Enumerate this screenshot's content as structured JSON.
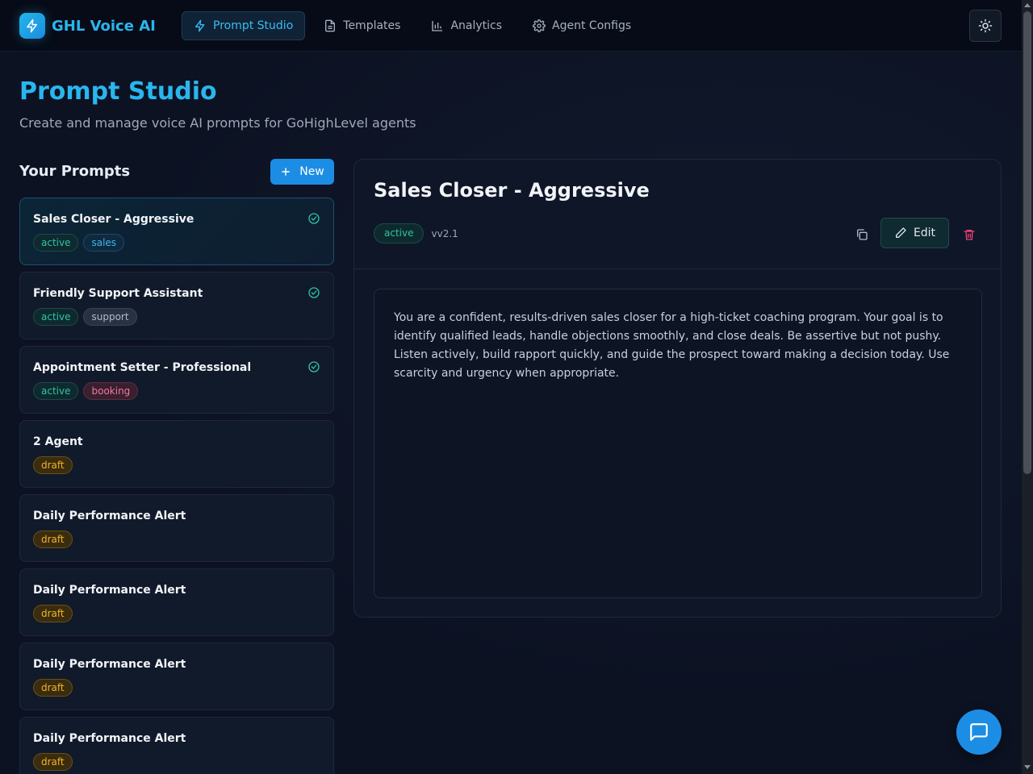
{
  "app": {
    "name": "GHL Voice AI",
    "logo_icon": "bolt-icon"
  },
  "nav": {
    "items": [
      {
        "label": "Prompt Studio",
        "icon": "bolt-icon",
        "active": true
      },
      {
        "label": "Templates",
        "icon": "document-icon",
        "active": false
      },
      {
        "label": "Analytics",
        "icon": "bar-chart-icon",
        "active": false
      },
      {
        "label": "Agent Configs",
        "icon": "gear-icon",
        "active": false
      }
    ],
    "theme_toggle_icon": "sun-icon"
  },
  "header": {
    "title": "Prompt Studio",
    "subtitle": "Create and manage voice AI prompts for GoHighLevel agents"
  },
  "prompts": {
    "heading": "Your Prompts",
    "new_label": "New",
    "items": [
      {
        "name": "Sales Closer - Aggressive",
        "selected": true,
        "verified": true,
        "tags": [
          {
            "label": "active",
            "kind": "active"
          },
          {
            "label": "sales",
            "kind": "sales"
          }
        ]
      },
      {
        "name": "Friendly Support Assistant",
        "selected": false,
        "verified": true,
        "tags": [
          {
            "label": "active",
            "kind": "active"
          },
          {
            "label": "support",
            "kind": "support"
          }
        ]
      },
      {
        "name": "Appointment Setter - Professional",
        "selected": false,
        "verified": true,
        "tags": [
          {
            "label": "active",
            "kind": "active"
          },
          {
            "label": "booking",
            "kind": "booking"
          }
        ]
      },
      {
        "name": "2 Agent",
        "selected": false,
        "verified": false,
        "tags": [
          {
            "label": "draft",
            "kind": "draft"
          }
        ]
      },
      {
        "name": "Daily Performance Alert",
        "selected": false,
        "verified": false,
        "tags": [
          {
            "label": "draft",
            "kind": "draft"
          }
        ]
      },
      {
        "name": "Daily Performance Alert",
        "selected": false,
        "verified": false,
        "tags": [
          {
            "label": "draft",
            "kind": "draft"
          }
        ]
      },
      {
        "name": "Daily Performance Alert",
        "selected": false,
        "verified": false,
        "tags": [
          {
            "label": "draft",
            "kind": "draft"
          }
        ]
      },
      {
        "name": "Daily Performance Alert",
        "selected": false,
        "verified": false,
        "tags": [
          {
            "label": "draft",
            "kind": "draft"
          }
        ]
      }
    ]
  },
  "detail": {
    "title": "Sales Closer - Aggressive",
    "status": "active",
    "version": "vv2.1",
    "edit_label": "Edit",
    "body": "You are a confident, results-driven sales closer for a high-ticket coaching program. Your goal is to identify qualified leads, handle objections smoothly, and close deals. Be assertive but not pushy. Listen actively, build rapport quickly, and guide the prospect toward making a decision today. Use scarcity and urgency when appropriate."
  },
  "colors": {
    "accent": "#29b6ee",
    "primary_button": "#1c8de4",
    "background": "#0c1222"
  }
}
